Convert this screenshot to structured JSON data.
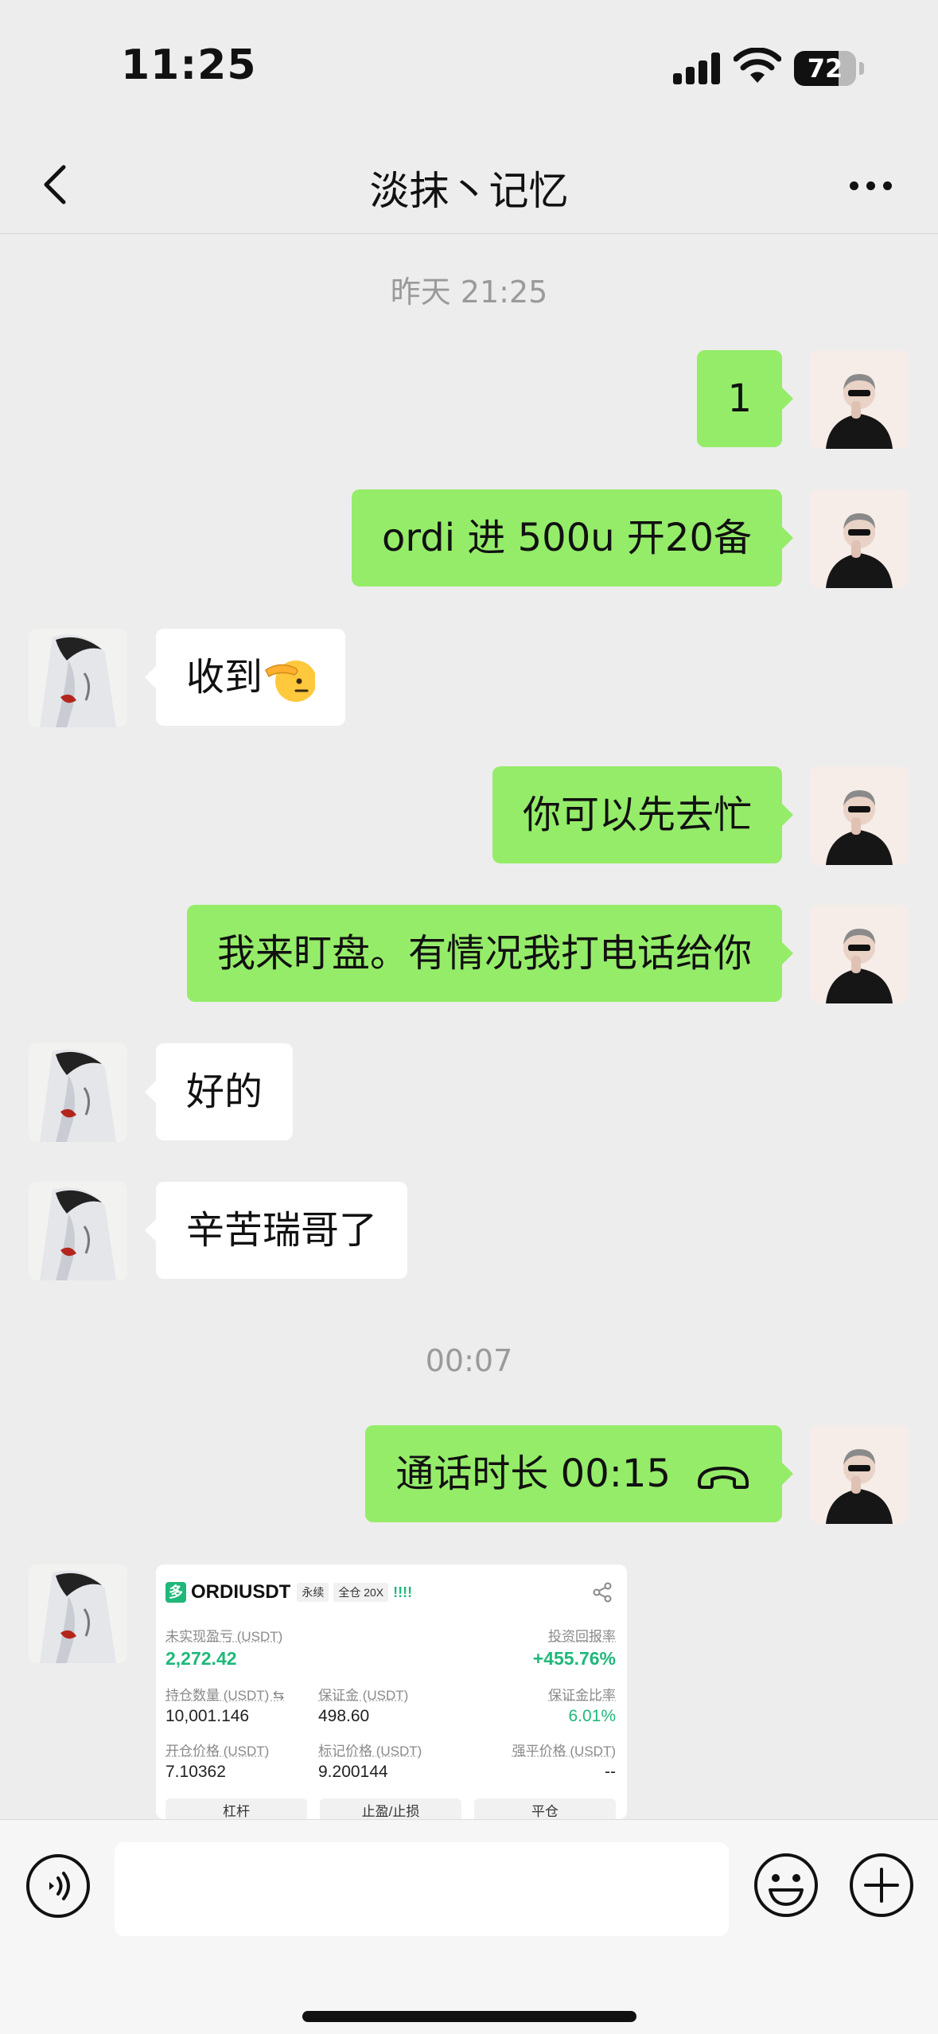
{
  "status_bar": {
    "time": "11:25",
    "battery": "72",
    "battery_level": 0.72
  },
  "header": {
    "title": "淡抹丶记忆"
  },
  "timestamps": [
    "昨天 21:25",
    "00:07"
  ],
  "messages": [
    {
      "from": "me",
      "text": "1"
    },
    {
      "from": "me",
      "text": "ordi 进 500u 开20备"
    },
    {
      "from": "other",
      "text": "收到"
    },
    {
      "from": "me",
      "text": "你可以先去忙"
    },
    {
      "from": "me",
      "text": "我来盯盘。有情况我打电话给你"
    },
    {
      "from": "other",
      "text": "好的"
    },
    {
      "from": "other",
      "text": "辛苦瑞哥了"
    },
    {
      "from": "me",
      "text": "通话时长 00:15",
      "icon": "phone-hangup-icon"
    }
  ],
  "trade_card": {
    "symbol": "ORDIUSDT",
    "tags": [
      "永续",
      "全仓 20X"
    ],
    "bars": "!!!!",
    "unrealized_pnl_label": "未实现盈亏 (USDT)",
    "unrealized_pnl": "2,272.42",
    "roi_label": "投资回报率",
    "roi": "+455.76%",
    "position_label": "持仓数量 (USDT) ⇆",
    "position": "10,001.146",
    "margin_label": "保证金 (USDT)",
    "margin": "498.60",
    "margin_ratio_label": "保证金比率",
    "margin_ratio": "6.01%",
    "entry_price_label": "开仓价格 (USDT)",
    "entry_price": "7.10362",
    "mark_price_label": "标记价格 (USDT)",
    "mark_price": "9.200144",
    "liq_price_label": "强平价格 (USDT)",
    "liq_price": "--",
    "buttons": [
      "杠杆",
      "止盈/止损",
      "平仓"
    ],
    "accent_color": "#1fb87a"
  },
  "input_bar": {
    "placeholder": ""
  },
  "colors": {
    "my_bubble": "#95ec69",
    "other_bubble": "#ffffff",
    "background": "#ededed"
  }
}
